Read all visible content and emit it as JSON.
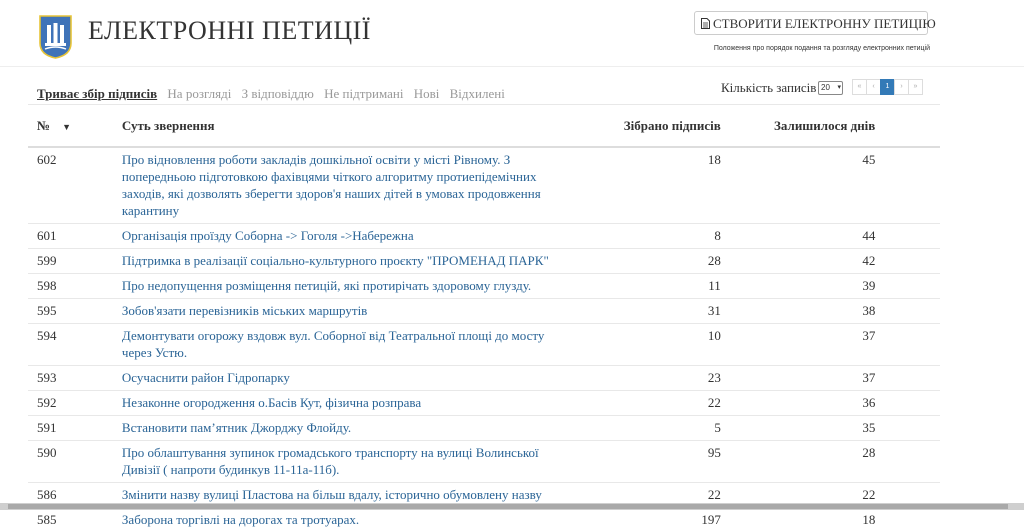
{
  "header": {
    "site_title": "ЕЛЕКТРОННІ ПЕТИЦІЇ",
    "create_button": "СТВОРИТИ ЕЛЕКТРОННУ ПЕТИЦІЮ",
    "rules_link": "Положення про порядок подання та розгляду електронних петицій"
  },
  "tabs": [
    {
      "label": "Триває збір підписів",
      "active": true
    },
    {
      "label": "На розгляді"
    },
    {
      "label": "З відповіддю"
    },
    {
      "label": "Не підтримані"
    },
    {
      "label": "Нові"
    },
    {
      "label": "Відхилені"
    }
  ],
  "records": {
    "label": "Кількість записів",
    "value": "20"
  },
  "pagination": {
    "first": "«",
    "prev": "‹",
    "current": "1",
    "next": "›",
    "last": "»"
  },
  "table": {
    "headers": {
      "num": "№",
      "title": "Суть звернення",
      "signatures": "Зібрано підписів",
      "days_left": "Залишилося днів"
    },
    "rows": [
      {
        "num": "602",
        "title": "Про відновлення роботи закладів дошкільної освіти у місті Рівному. З попередньою підготовкою фахівцями чіткого алгоритму протиепідемічних заходів, які дозволять зберегти здоров'я наших дітей в умовах продовження карантину",
        "signatures": "18",
        "days_left": "45"
      },
      {
        "num": "601",
        "title": "Організація проїзду Соборна -> Гоголя ->Набережна",
        "signatures": "8",
        "days_left": "44"
      },
      {
        "num": "599",
        "title": "Підтримка в реалізації соціально-культурного проєкту \"ПРОМЕНАД ПАРК\"",
        "signatures": "28",
        "days_left": "42"
      },
      {
        "num": "598",
        "title": "Про недопущення розміщення петицій, які протирічать здоровому глузду.",
        "signatures": "11",
        "days_left": "39"
      },
      {
        "num": "595",
        "title": "Зобов'язати перевізників міських маршрутів",
        "signatures": "31",
        "days_left": "38"
      },
      {
        "num": "594",
        "title": "Демонтувати огорожу вздовж вул. Соборної від Театральної площі до мосту через Устю.",
        "signatures": "10",
        "days_left": "37"
      },
      {
        "num": "593",
        "title": "Осучаснити район Гідропарку",
        "signatures": "23",
        "days_left": "37"
      },
      {
        "num": "592",
        "title": "Незаконне огородження о.Басів Кут, фізична розправа",
        "signatures": "22",
        "days_left": "36"
      },
      {
        "num": "591",
        "title": "Встановити пам’ятник Джорджу Флойду.",
        "signatures": "5",
        "days_left": "35"
      },
      {
        "num": "590",
        "title": "Про облаштування зупинок громадського транспорту на вулиці Волинської Дивізії ( напроти будинкув 11-11а-11б).",
        "signatures": "95",
        "days_left": "28"
      },
      {
        "num": "586",
        "title": "Змінити назву вулиці Пластова на більш вдалу, історично обумовлену назву",
        "signatures": "22",
        "days_left": "22"
      },
      {
        "num": "585",
        "title": "Заборона торгівлі на дорогах та тротуарах.",
        "signatures": "197",
        "days_left": "18"
      }
    ]
  },
  "colors": {
    "link": "#2a6496",
    "pager_active": "#337ab7",
    "logo_blue": "#3f73b8",
    "logo_gold": "#e7c437"
  }
}
